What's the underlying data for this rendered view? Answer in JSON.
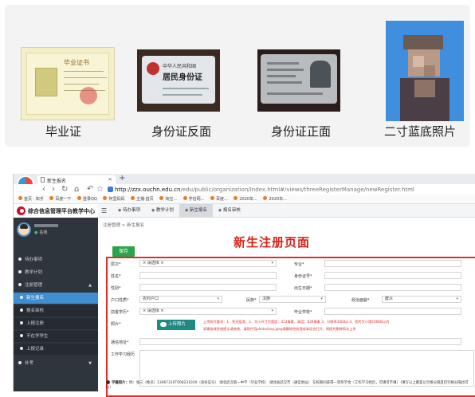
{
  "documents": [
    {
      "caption": "毕业证",
      "icon": "diploma-image",
      "diploma_title": "毕业证书"
    },
    {
      "caption": "身份证反面",
      "icon": "id-card-back-image",
      "country": "中华人民共和国",
      "card_title": "居民身份证"
    },
    {
      "caption": "身份证正面",
      "icon": "id-card-front-image"
    },
    {
      "caption": "二寸蓝底照片",
      "icon": "portrait-photo-image"
    }
  ],
  "browser": {
    "tab_title": "新生报名",
    "new_tab": "+",
    "url_host": "http://zzx.ouchn.edu.cn",
    "url_path": "/edu/public/organization/Index.html#/views/threeRegisterManage/newRegister.html",
    "bookmarks": [
      "首页 · 知乎",
      "百度一下",
      "登录QQ",
      "阿里妈妈",
      "主播·首页",
      "淘宝...",
      "学信网...",
      "百度...",
      "2020年...",
      "2020年..."
    ]
  },
  "app": {
    "name": "综合信息管理平台教学中心",
    "top_tabs": [
      "待办事项",
      "教学计划",
      "新生报名",
      "报名审核"
    ],
    "breadcrumb": "注册管理 > 新生报名",
    "user_status": "在线",
    "sidebar": {
      "items": [
        "待办事项",
        "教学计划",
        "注册管理",
        "新生报名",
        "报名审核",
        "上报注册",
        "不在学学生",
        "上报记录",
        "补考"
      ]
    },
    "save_label": "保存",
    "overlay_title": "新生注册页面",
    "upload_label": "上传照片",
    "form": {
      "major_label": "层次*",
      "major_value": "× 请选择 ×",
      "major_opt_label": "专业*",
      "name_label": "姓名*",
      "id_label": "身份证号*",
      "gender_label": "性别*",
      "birth_label": "出生日期*",
      "hukou_label": "户口性质*",
      "hukou_value": "农村户口",
      "ethnic_label": "民族*",
      "ethnic_value": "汉族",
      "politics_label": "政治面貌*",
      "politics_value": "群众",
      "edu_label": "前置学历*",
      "edu_value": "× 请选择 ×",
      "grad_school_label": "毕业学校*",
      "photo_label": "照片*",
      "hint_1": "上传照片要求：1、免冠蓝底；2、大小尺寸为宽度：413像素，高度：626像素 3、分辨率300dpi 4、图片大小限500KB以内",
      "hint_2": "如需修改系统提示请修改，请照片用photoshop,jpeg请删除把处理成本适合打开，将照片删掉再次上传",
      "address_label": "通信地址*",
      "resume_label": "工作学习经历"
    },
    "footnote_label": "学籍照片：",
    "footnote_text": "例：张三（姓名）13067310T00823103X（身份证号） 湖北武汉第一中学（毕业学校） 湖北省武汉市（通信地址） 在校期间获得一等奖学金（工作学习经历，可填可不填）（填写以上都是以空格分隔且仅空格分隔也可以）"
  }
}
